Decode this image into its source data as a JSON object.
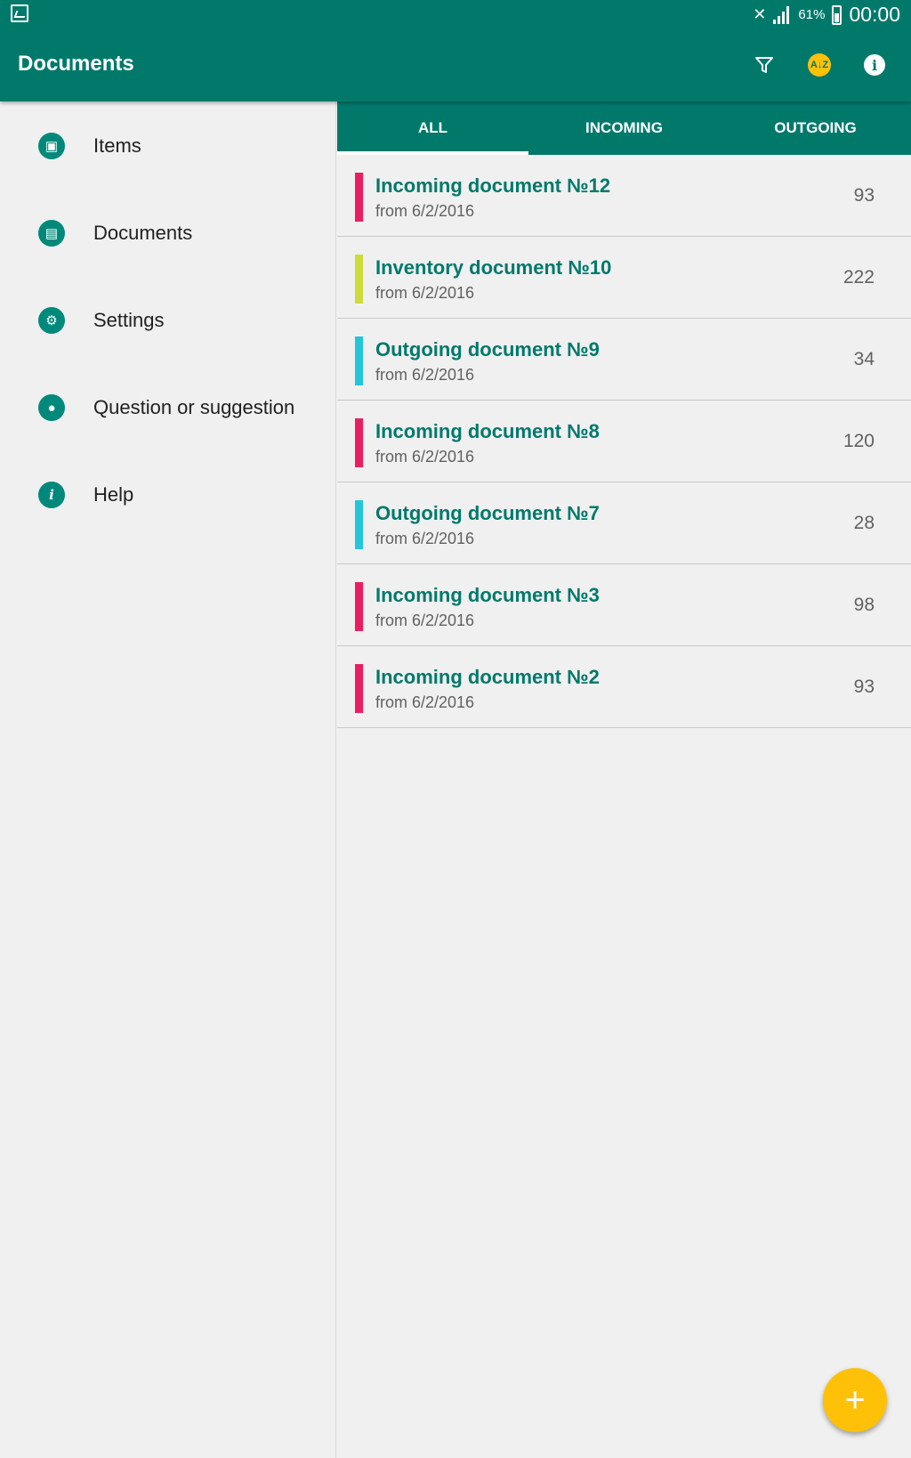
{
  "status_bar": {
    "battery": "61%",
    "time": "00:00",
    "icons": [
      "gallery-icon",
      "mute-icon",
      "signal-icon",
      "battery-icon"
    ]
  },
  "app_bar": {
    "title": "Documents",
    "actions": [
      "filter-icon",
      "sort-icon",
      "info-icon"
    ],
    "sort_icon_text": "A↓Z"
  },
  "drawer": {
    "items": [
      {
        "label": "Items",
        "icon": "box-icon",
        "glyph": "▣"
      },
      {
        "label": "Documents",
        "icon": "document-icon",
        "glyph": "▤"
      },
      {
        "label": "Settings",
        "icon": "gear-icon",
        "glyph": "⚙"
      },
      {
        "label": "Question or suggestion",
        "icon": "chat-icon",
        "glyph": "●"
      },
      {
        "label": "Help",
        "icon": "info-icon",
        "glyph": "i"
      }
    ]
  },
  "tabs": [
    {
      "label": "ALL",
      "active": true
    },
    {
      "label": "INCOMING",
      "active": false
    },
    {
      "label": "OUTGOING",
      "active": false
    }
  ],
  "documents": [
    {
      "title": "Incoming document №12",
      "date": "from 6/2/2016",
      "count": "93",
      "color": "#e91e63"
    },
    {
      "title": "Inventory document №10",
      "date": "from 6/2/2016",
      "count": "222",
      "color": "#cddc39"
    },
    {
      "title": "Outgoing document №9",
      "date": "from 6/2/2016",
      "count": "34",
      "color": "#26c6da"
    },
    {
      "title": "Incoming document №8",
      "date": "from 6/2/2016",
      "count": "120",
      "color": "#e91e63"
    },
    {
      "title": "Outgoing document №7",
      "date": "from 6/2/2016",
      "count": "28",
      "color": "#26c6da"
    },
    {
      "title": "Incoming document №3",
      "date": "from 6/2/2016",
      "count": "98",
      "color": "#e91e63"
    },
    {
      "title": "Incoming document №2",
      "date": "from 6/2/2016",
      "count": "93",
      "color": "#e91e63"
    }
  ],
  "fab": {
    "label": "+",
    "icon": "plus-icon"
  },
  "colors": {
    "primary": "#00796b",
    "accent": "#ffc107",
    "background": "#f0f0f0"
  }
}
